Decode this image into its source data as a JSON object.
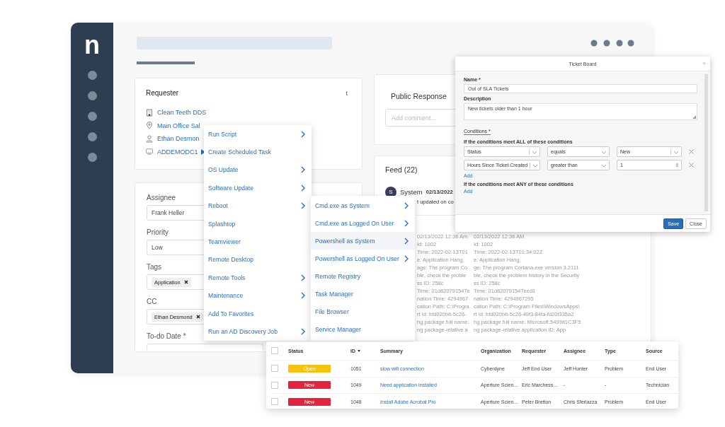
{
  "sidebar": {
    "logo": "n"
  },
  "requester": {
    "title": "Requester",
    "corner_text": "t",
    "links": [
      {
        "kind": "building",
        "text": "Clean Teeth DDS"
      },
      {
        "kind": "location",
        "text": "Main Office Sal"
      },
      {
        "kind": "person",
        "text": "Ethan Desmon"
      },
      {
        "kind": "device",
        "text": "ADDEMODC1"
      }
    ]
  },
  "form": {
    "fields": [
      {
        "label": "Assignee",
        "kind": "text",
        "value": "Frank Heller"
      },
      {
        "label": "Priority",
        "kind": "text",
        "value": "Low"
      },
      {
        "label": "Tags",
        "kind": "chips",
        "chips": [
          "Application"
        ]
      },
      {
        "label": "CC",
        "kind": "chips",
        "chips": [
          "Ethan Desmond"
        ]
      },
      {
        "label": "To-do Date *",
        "kind": "blank"
      }
    ]
  },
  "public_response": {
    "title": "Public Response",
    "placeholder": "Add comment..."
  },
  "feed": {
    "title": "Feed (22)",
    "author_avatar": "S",
    "author": "System",
    "date": "02/13/2022",
    "first_line": "t updated on co",
    "lines": [
      {
        "left": "02/13/2022 12:36 Am",
        "right": "02/13/2022 12:36 AM"
      },
      {
        "left": "Id: 1002",
        "right": "Id: 1002"
      },
      {
        "left": "Time: 2022-02-13T01",
        "right": "Time: 2022-02-13T01:34:02Z"
      },
      {
        "left": "e: Application Hang",
        "right": "e: Application Hang"
      },
      {
        "left": "age: The program Co",
        "right": "ge: The program Cortana.exe version 3.2111"
      },
      {
        "left": "ble, check the proble",
        "right": "ble, check the problem history in the Security"
      },
      {
        "left": "ss ID: 258c",
        "right": "ss ID: 258c"
      },
      {
        "left": "Time: 01d820791547e",
        "right": "Time: 01d820791547eed1"
      },
      {
        "left": "nation Time: 4294967",
        "right": "nation Time: 4294967295"
      },
      {
        "left": "cation Path: C:\\Progra",
        "right": "cation Path: C:\\Program Files\\WindowsApps\\"
      },
      {
        "left": "rt Id: bfd020bb-5c26-",
        "right": "rt Id: bfd020bb-5c26-49f3-84fa-fd20f335a2"
      },
      {
        "left": "ng package full name:",
        "right": "ng package full name: Microsoft.549981C3F5"
      },
      {
        "left": "ng package-relative a",
        "right": "ng package-relative application ID: App"
      }
    ]
  },
  "menu": {
    "items": [
      {
        "label": "Run Script",
        "submenu": true,
        "selected": false
      },
      {
        "label": "Create Scheduled Task",
        "submenu": false,
        "selected": false
      },
      {
        "label": "OS Update",
        "submenu": true,
        "selected": false
      },
      {
        "label": "Software Update",
        "submenu": true,
        "selected": false
      },
      {
        "label": "Reboot",
        "submenu": true,
        "selected": false
      },
      {
        "label": "Splashtop",
        "submenu": false,
        "selected": false
      },
      {
        "label": "Teamviewer",
        "submenu": false,
        "selected": false
      },
      {
        "label": "Remote Desktop",
        "submenu": false,
        "selected": false
      },
      {
        "label": "Remote Tools",
        "submenu": true,
        "selected": false
      },
      {
        "label": "Maintenance",
        "submenu": true,
        "selected": false
      },
      {
        "label": "Add To Favorites",
        "submenu": false,
        "selected": false
      },
      {
        "label": "Run an AD Discovery Job",
        "submenu": true,
        "selected": false
      }
    ]
  },
  "submenu": {
    "items": [
      {
        "label": "Cmd.exe as System",
        "submenu": true,
        "selected": false
      },
      {
        "label": "Cmd.exe as Logged On User",
        "submenu": true,
        "selected": false
      },
      {
        "label": "Powershell as System",
        "submenu": true,
        "selected": true
      },
      {
        "label": "Powershell as Logged On User",
        "submenu": true,
        "selected": false
      },
      {
        "label": "Remote Registry",
        "submenu": false,
        "selected": false
      },
      {
        "label": "Task Manager",
        "submenu": false,
        "selected": false
      },
      {
        "label": "File Browser",
        "submenu": false,
        "selected": false
      },
      {
        "label": "Service Manager",
        "submenu": false,
        "selected": false
      }
    ]
  },
  "dialog": {
    "title": "Ticket Board",
    "close": "×",
    "name_label": "Name *",
    "name_value": "Out of SLA Tickets",
    "description_label": "Description",
    "description_value": "New tickets older than 1 hour",
    "tab": "Conditions *",
    "all_heading": "If the conditions meet ALL of these conditions",
    "all_rows": [
      {
        "field": "Status",
        "operator": "equals",
        "value": "New",
        "kind": "select"
      },
      {
        "field": "Hours Since Ticket Created",
        "operator": "greater than",
        "value": "1",
        "kind": "number"
      }
    ],
    "all_add": "Add",
    "any_heading": "If the conditions meet ANY of these conditions",
    "any_add": "Add",
    "buttons": [
      {
        "label": "Save",
        "kind": "primary"
      },
      {
        "label": "Close",
        "kind": "secondary"
      }
    ]
  },
  "table": {
    "header_checked": false,
    "columns": [
      {
        "label": "Status",
        "sorted": false
      },
      {
        "label": "ID",
        "sorted": true
      },
      {
        "label": "Summary",
        "sorted": false
      },
      {
        "label": "Organization",
        "sorted": false
      },
      {
        "label": "Requester",
        "sorted": false
      },
      {
        "label": "Assignee",
        "sorted": false
      },
      {
        "label": "Type",
        "sorted": false
      },
      {
        "label": "Source",
        "sorted": false
      }
    ],
    "rows": [
      {
        "checked": false,
        "status": "Open",
        "color": "#f7c20f",
        "id": "1051",
        "summary": "slow wifi connection",
        "organization": "Cyberdyne",
        "requester": "Jeff End User",
        "assignee": "Jeff Hunter",
        "type": "Problem",
        "source": "End User"
      },
      {
        "checked": false,
        "status": "New",
        "color": "#e4233f",
        "id": "1049",
        "summary": "Need application installed",
        "organization": "Aperture Scien...",
        "requester": "Eric Marchess...",
        "assignee": "-",
        "type": "-",
        "source": "Technician"
      },
      {
        "checked": false,
        "status": "New",
        "color": "#e4233f",
        "id": "1048",
        "summary": "Install Adobe Acrobat Pro",
        "organization": "Aperture Scien...",
        "requester": "Peter Bretton",
        "assignee": "Chris Sferlazza",
        "type": "Problem",
        "source": "End User"
      }
    ]
  }
}
